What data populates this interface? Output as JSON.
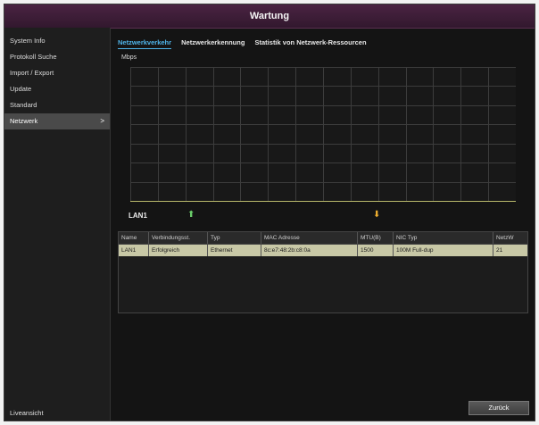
{
  "window": {
    "title": "Wartung"
  },
  "sidebar": {
    "items": [
      {
        "label": "System Info"
      },
      {
        "label": "Protokoll Suche"
      },
      {
        "label": "Import / Export"
      },
      {
        "label": "Update"
      },
      {
        "label": "Standard"
      },
      {
        "label": "Netzwerk",
        "chevron": ">"
      }
    ],
    "live_view_label": "Liveansicht"
  },
  "tabs": [
    {
      "label": "Netzwerkverkehr"
    },
    {
      "label": "Netzwerkerkennung"
    },
    {
      "label": "Statistik von Netzwerk-Ressourcen"
    }
  ],
  "graph": {
    "unit_label": "Mbps",
    "interface_label": "LAN1"
  },
  "table": {
    "headers": [
      "Name",
      "Verbindungsst.",
      "Typ",
      "MAC Adresse",
      "MTU(B)",
      "NIC Typ",
      "NetzW"
    ],
    "rows": [
      [
        "LAN1",
        "Erfolgreich",
        "Ethernet",
        "8c:e7:48:2b:c8:0a",
        "1500",
        "100M Full-dup",
        "21"
      ]
    ]
  },
  "footer": {
    "back_label": "Zurück"
  },
  "colors": {
    "title_bar": "#3b1b36",
    "active_tab": "#4fb3e8",
    "selected_row": "#c8c8a6",
    "upload_arrow": "#6cd06c",
    "download_arrow": "#f0b030"
  }
}
